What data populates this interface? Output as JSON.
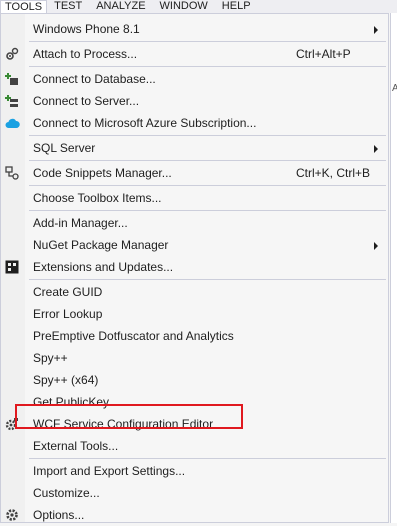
{
  "menubar": {
    "items": [
      {
        "label": "TOOLS"
      },
      {
        "label": "TEST"
      },
      {
        "label": "ANALYZE"
      },
      {
        "label": "WINDOW"
      },
      {
        "label": "HELP"
      }
    ]
  },
  "right_strip": {
    "text": "AC"
  },
  "menu": {
    "items": [
      {
        "label": "Windows Phone 8.1",
        "shortcut": "",
        "submenu": true
      },
      {
        "label": "Attach to Process...",
        "shortcut": "Ctrl+Alt+P"
      },
      {
        "label": "Connect to Database...",
        "shortcut": ""
      },
      {
        "label": "Connect to Server...",
        "shortcut": ""
      },
      {
        "label": "Connect to Microsoft Azure Subscription...",
        "shortcut": ""
      },
      {
        "label": "SQL Server",
        "shortcut": "",
        "submenu": true
      },
      {
        "label": "Code Snippets Manager...",
        "shortcut": "Ctrl+K, Ctrl+B"
      },
      {
        "label": "Choose Toolbox Items...",
        "shortcut": ""
      },
      {
        "label": "Add-in Manager...",
        "shortcut": ""
      },
      {
        "label": "NuGet Package Manager",
        "shortcut": "",
        "submenu": true
      },
      {
        "label": "Extensions and Updates...",
        "shortcut": ""
      },
      {
        "label": "Create GUID",
        "shortcut": ""
      },
      {
        "label": "Error Lookup",
        "shortcut": ""
      },
      {
        "label": "PreEmptive Dotfuscator and Analytics",
        "shortcut": ""
      },
      {
        "label": "Spy++",
        "shortcut": ""
      },
      {
        "label": "Spy++ (x64)",
        "shortcut": ""
      },
      {
        "label": "Get PublicKey",
        "shortcut": ""
      },
      {
        "label": "WCF Service Configuration Editor",
        "shortcut": ""
      },
      {
        "label": "External Tools...",
        "shortcut": ""
      },
      {
        "label": "Import and Export Settings...",
        "shortcut": ""
      },
      {
        "label": "Customize...",
        "shortcut": ""
      },
      {
        "label": "Options...",
        "shortcut": ""
      }
    ]
  },
  "colors": {
    "highlight_border": "#e0191f",
    "menu_bg": "#f6f6f6",
    "separator": "#cccedb"
  }
}
